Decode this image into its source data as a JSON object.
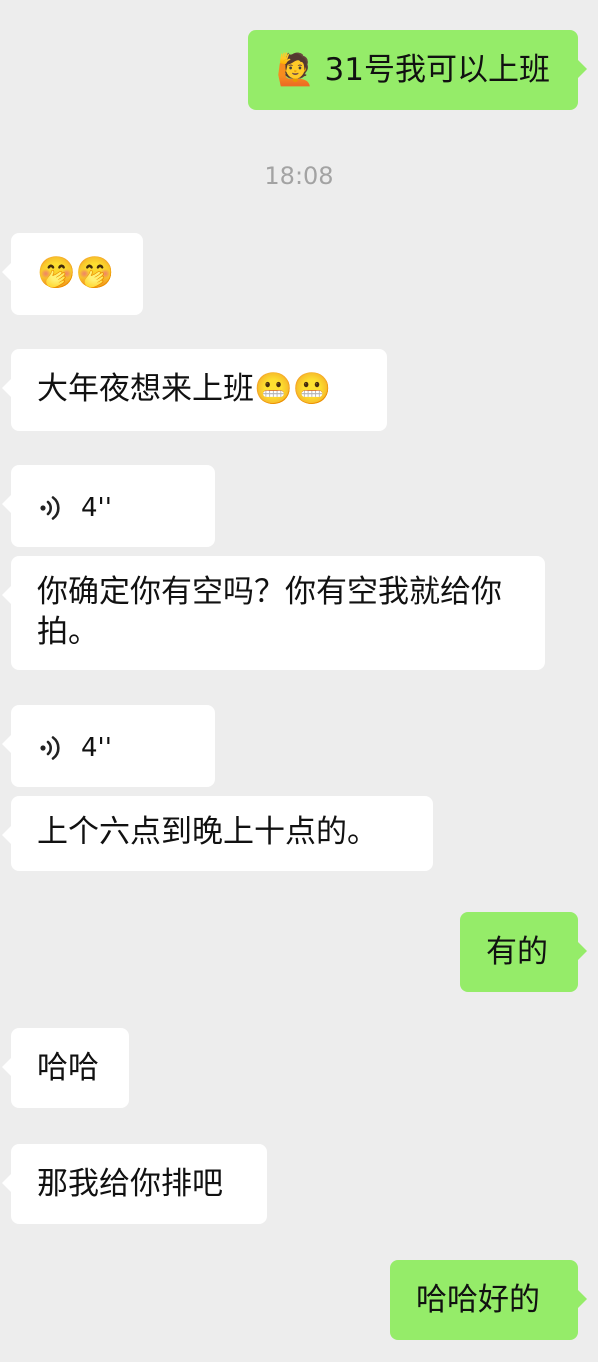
{
  "messages": [
    {
      "side": "out",
      "text": "🙋 31号我可以上班"
    },
    {
      "side": "system",
      "text": "18:08"
    },
    {
      "side": "in",
      "text": "🤭🤭"
    },
    {
      "side": "in",
      "text": "大年夜想来上班😬😬"
    },
    {
      "side": "in",
      "voice_duration": "4''"
    },
    {
      "side": "in",
      "text": "你确定你有空吗？你有空我就给你拍。"
    },
    {
      "side": "in",
      "voice_duration": "4''"
    },
    {
      "side": "in",
      "text": "上个六点到晚上十点的。"
    },
    {
      "side": "out",
      "text": "有的"
    },
    {
      "side": "in",
      "text": "哈哈"
    },
    {
      "side": "in",
      "text": "那我给你排吧"
    },
    {
      "side": "out",
      "text": "哈哈好的"
    }
  ],
  "icons": {
    "voice": "voice-wave-icon"
  }
}
